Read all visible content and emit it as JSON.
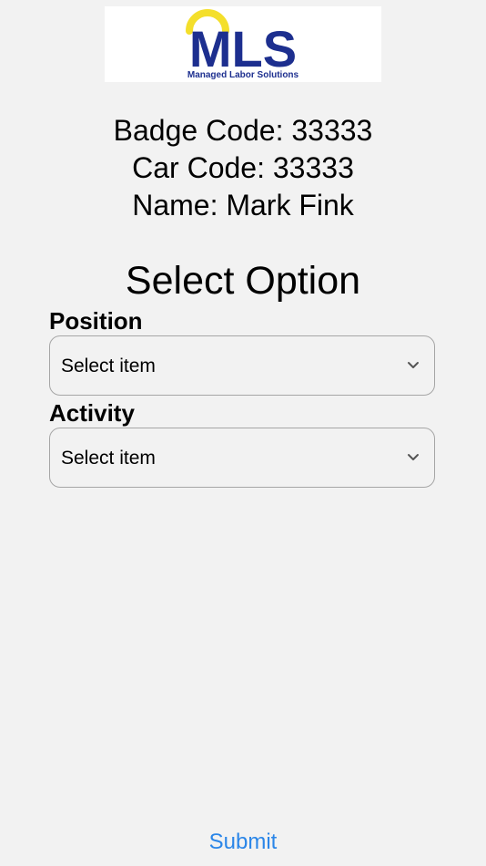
{
  "logo": {
    "text": "MLS",
    "tagline": "Managed Labor Solutions",
    "colors": {
      "navy": "#1d2f8f",
      "yellow": "#f4df2b"
    }
  },
  "user": {
    "badge_line": "Badge Code: 33333",
    "car_line": "Car Code: 33333",
    "name_line": "Name: Mark Fink"
  },
  "form": {
    "heading": "Select Option",
    "position": {
      "label": "Position",
      "value": "Select item"
    },
    "activity": {
      "label": "Activity",
      "value": "Select item"
    },
    "submit_label": "Submit"
  },
  "colors": {
    "background": "#f2f2f2",
    "accent": "#2b86e8",
    "border": "#a6a6a6"
  }
}
